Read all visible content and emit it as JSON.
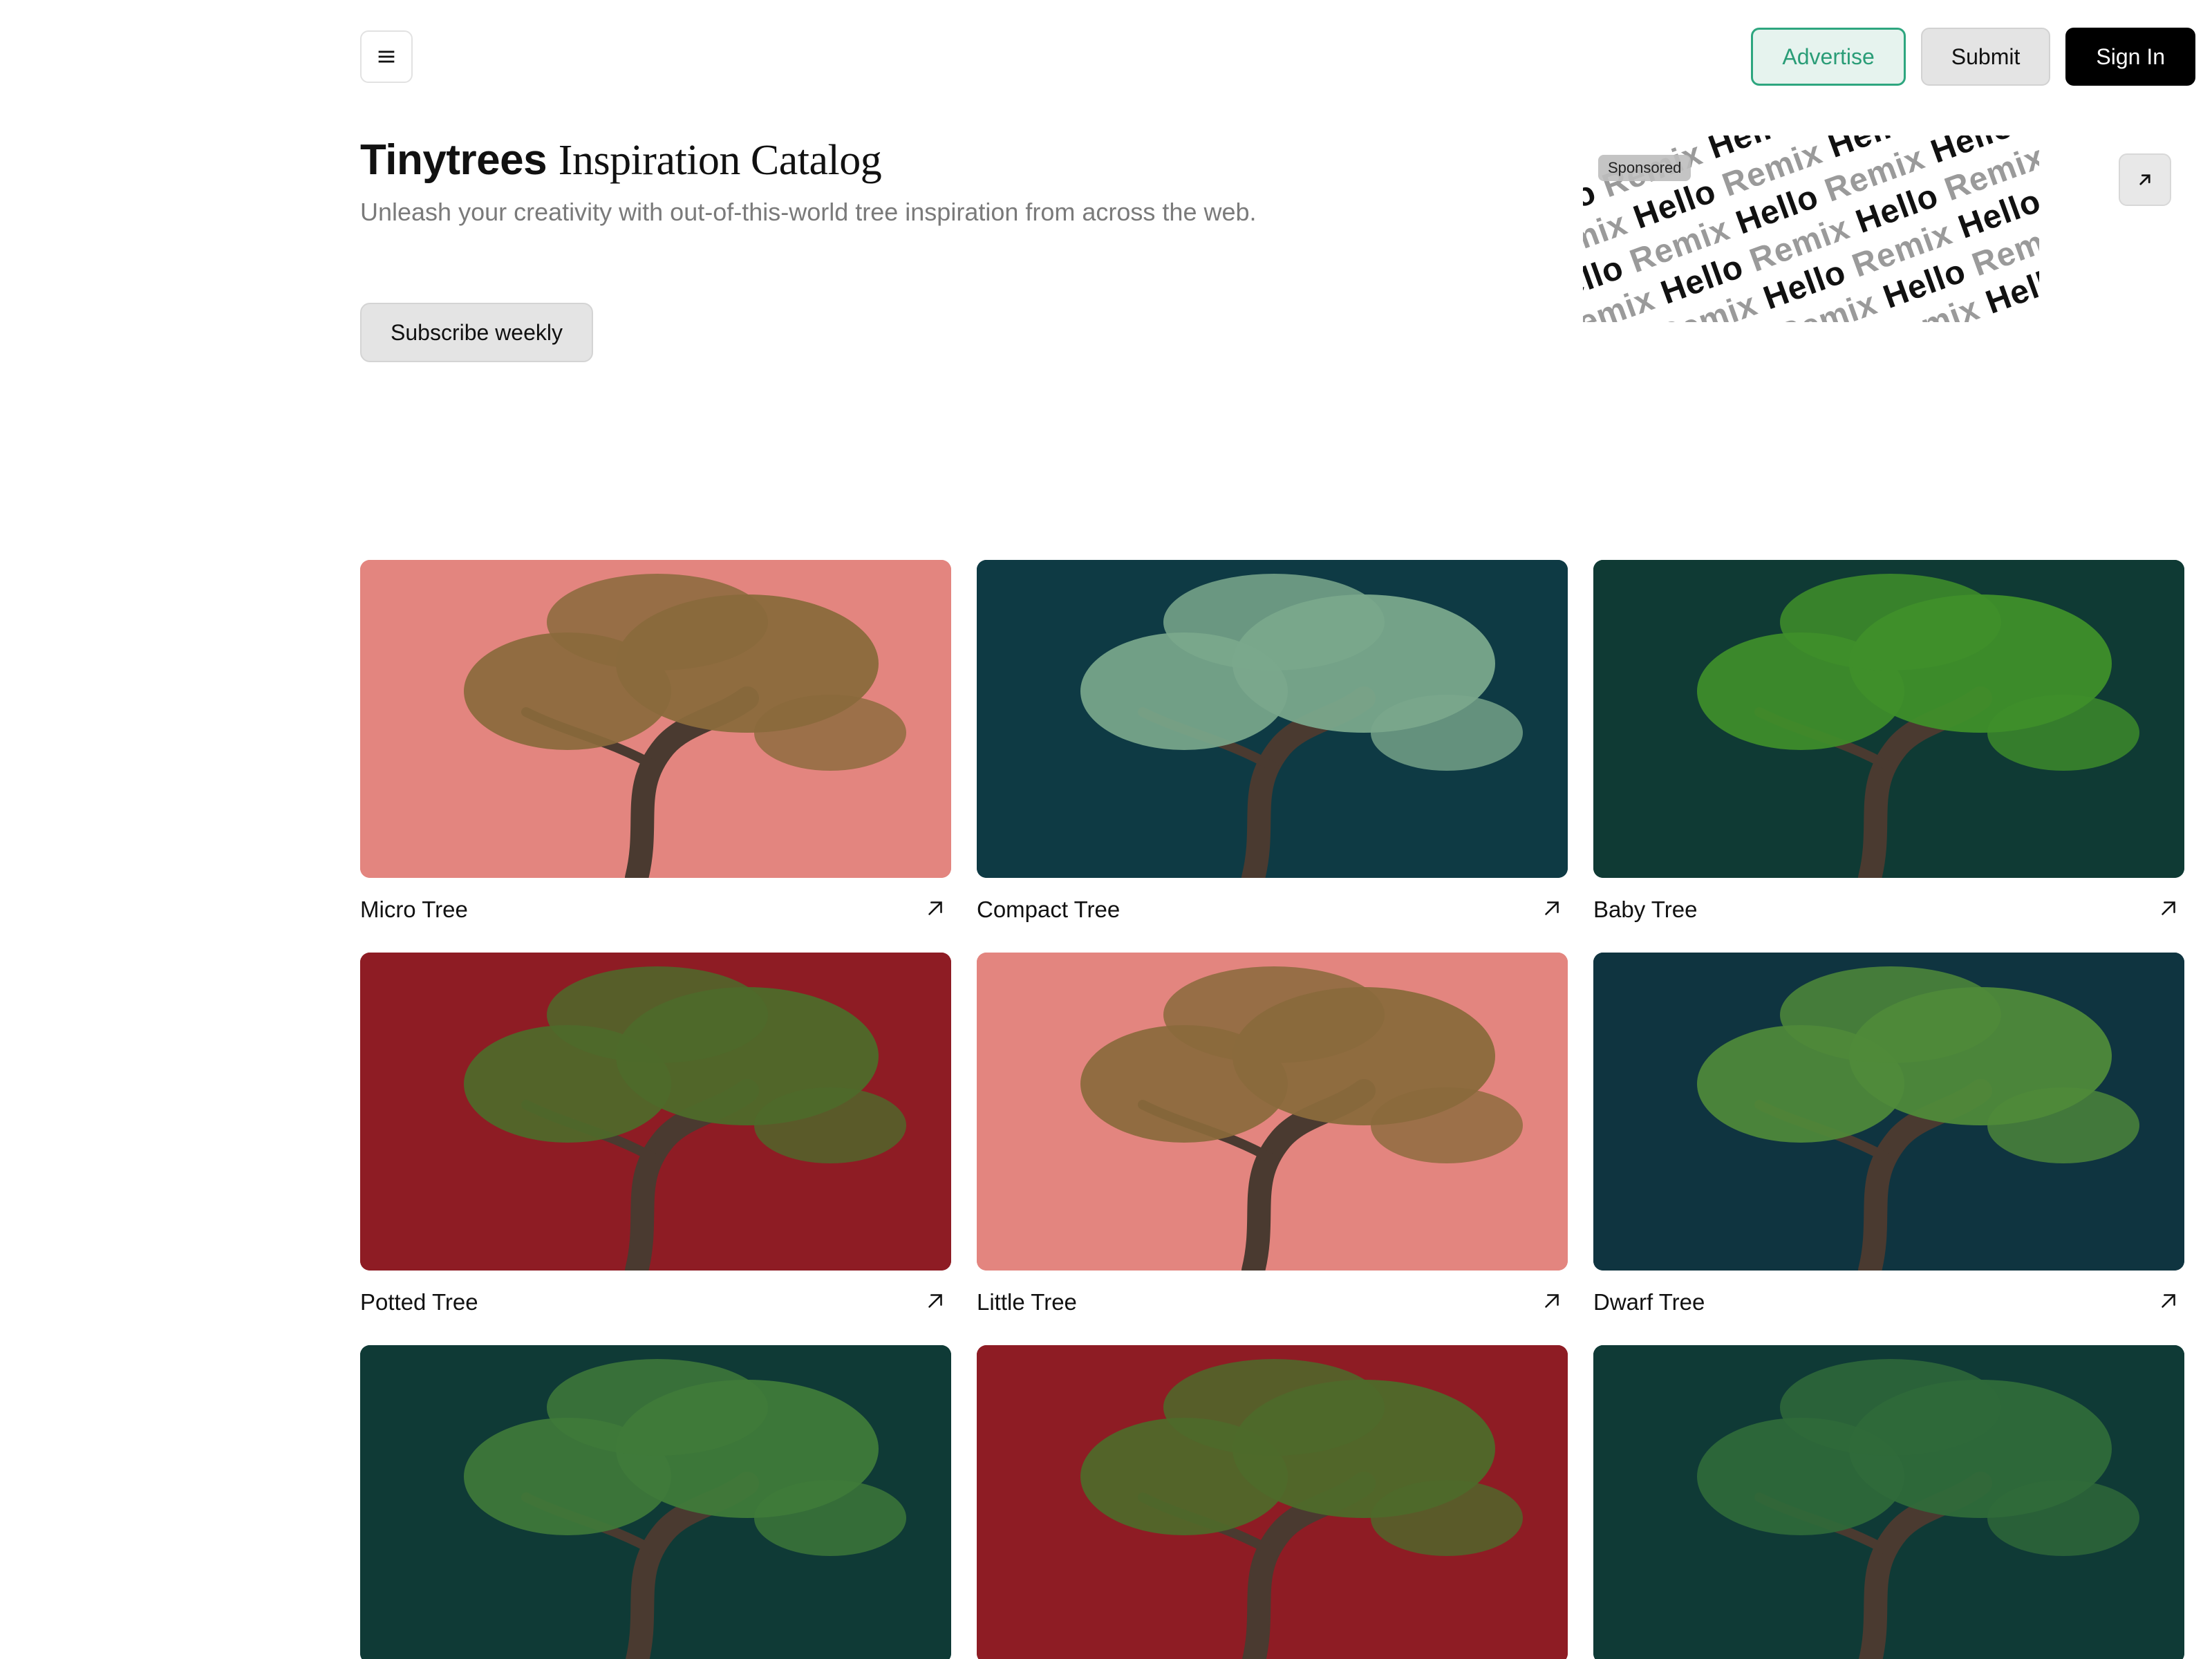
{
  "nav": {
    "menu_icon": "hamburger-menu-icon"
  },
  "actions": {
    "advertise": "Advertise",
    "submit": "Submit",
    "sign_in": "Sign In"
  },
  "hero": {
    "brand": "Tinytrees",
    "title_rest": "Inspiration Catalog",
    "subtitle": "Unleash your creativity with out-of-this-world tree inspiration from across the web.",
    "subscribe": "Subscribe weekly"
  },
  "ad": {
    "badge": "Sponsored",
    "word_primary": "Hello",
    "word_secondary": "Remix",
    "link_icon": "external-arrow-icon"
  },
  "cards": [
    {
      "title": "Micro Tree",
      "bg": "#e3857f",
      "foliage": "#8a6a3c"
    },
    {
      "title": "Compact Tree",
      "bg": "#0e3a44",
      "foliage": "#7aa88c"
    },
    {
      "title": "Baby Tree",
      "bg": "#0f3a34",
      "foliage": "#3f8f2a"
    },
    {
      "title": "Potted Tree",
      "bg": "#8e1c24",
      "foliage": "#4e6a2a"
    },
    {
      "title": "Little Tree",
      "bg": "#e3857f",
      "foliage": "#8a6a3c"
    },
    {
      "title": "Dwarf Tree",
      "bg": "#0f3440",
      "foliage": "#4f8a3a"
    },
    {
      "title": "",
      "bg": "#0f3a36",
      "foliage": "#3f7a3a"
    },
    {
      "title": "",
      "bg": "#8e1c24",
      "foliage": "#4e6a2a"
    },
    {
      "title": "",
      "bg": "#0f3a36",
      "foliage": "#2f6a3a"
    }
  ],
  "colors": {
    "accent": "#2ea67f",
    "primary": "#000000"
  }
}
